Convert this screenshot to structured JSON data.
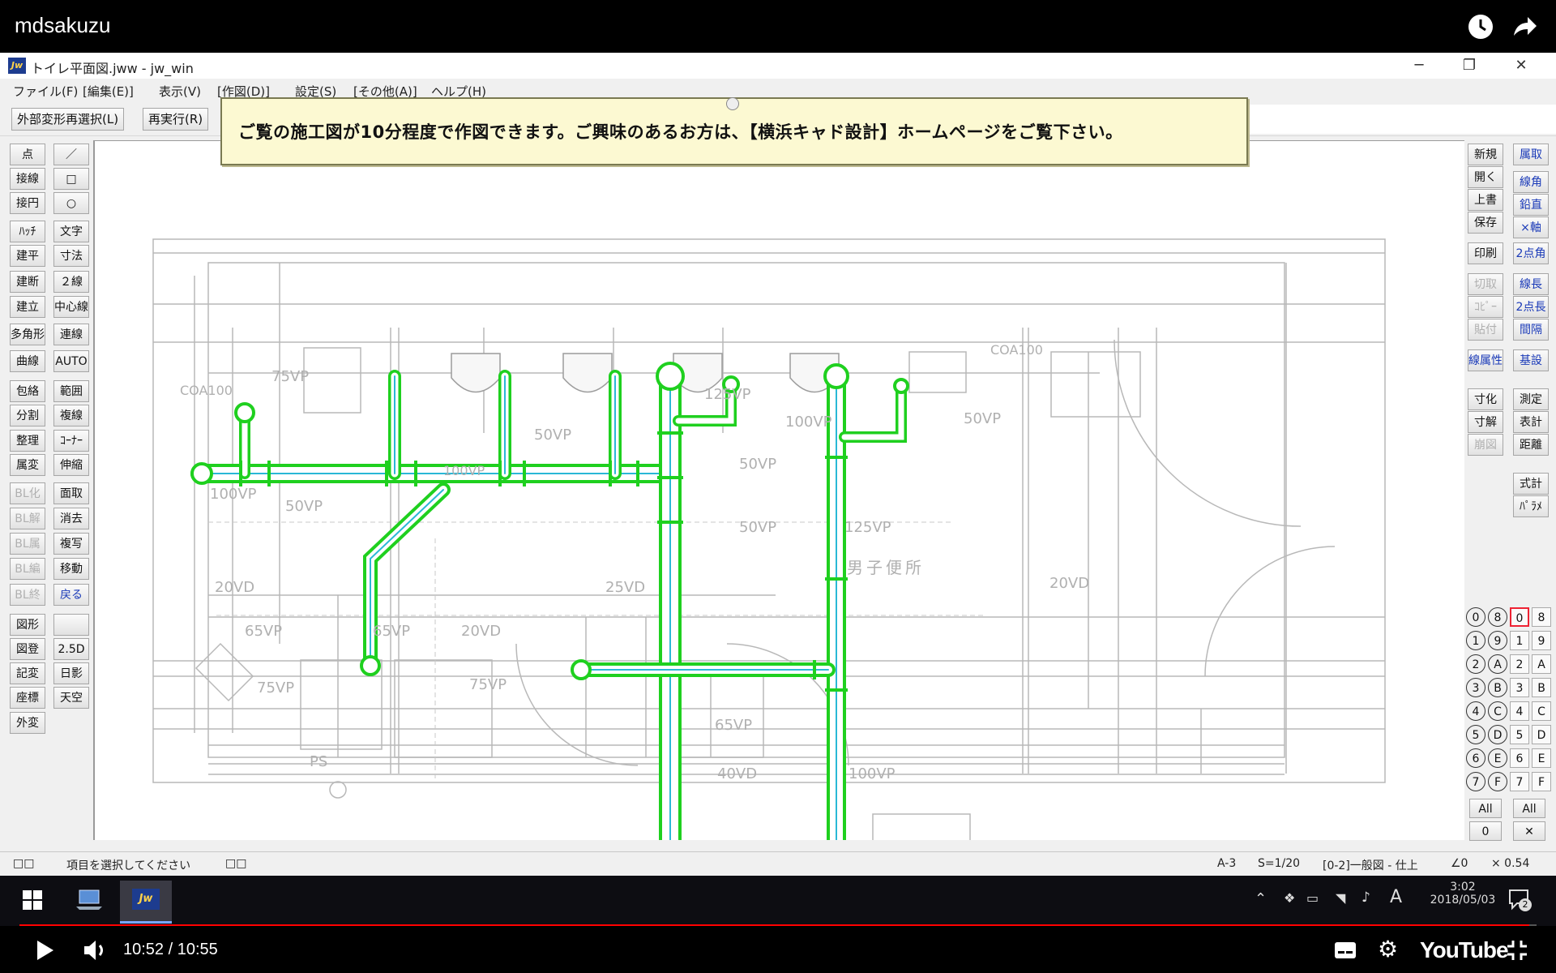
{
  "video": {
    "title": "mdsakuzu",
    "current_time": "10:52",
    "duration": "10:55",
    "time_display": "10:52 / 10:55",
    "progress": 0.995,
    "brand": "YouTube"
  },
  "window": {
    "title": "トイレ平面図.jww - jw_win",
    "app_icon_text": "Jw"
  },
  "menu": [
    "ファイル(F)",
    "[編集(E)]",
    "表示(V)",
    "[作図(D)]",
    "設定(S)",
    "[その他(A)]",
    "ヘルプ(H)"
  ],
  "command_bar": {
    "buttons": [
      "外部変形再選択(L)",
      "再実行(R)"
    ]
  },
  "left_tools": {
    "col1": [
      "点",
      "接線",
      "接円",
      "ﾊｯﾁ",
      "建平",
      "建断",
      "建立",
      "多角形",
      "曲線",
      "包絡",
      "分割",
      "整理",
      "属変",
      "BL化",
      "BL解",
      "BL属",
      "BL編",
      "BL終",
      "図形",
      "図登",
      "記変",
      "座標",
      "外変"
    ],
    "col2": [
      "／",
      "□",
      "○",
      "文字",
      "寸法",
      "２線",
      "中心線",
      "連線",
      "AUTO",
      "範囲",
      "複線",
      "ｺｰﾅｰ",
      "伸縮",
      "面取",
      "消去",
      "複写",
      "移動",
      "戻る",
      "",
      "2.5D",
      "日影",
      "天空"
    ]
  },
  "right_tools": {
    "col1": [
      "新規",
      "開く",
      "上書",
      "保存",
      "印刷",
      "切取",
      "ｺﾋﾟｰ",
      "貼付",
      "線属性",
      "寸化",
      "寸解",
      "崩図"
    ],
    "col2": [
      "属取",
      "線角",
      "鉛直",
      "×軸",
      "2点角",
      "線長",
      "2点長",
      "間隔",
      "基設",
      "測定",
      "表計",
      "距離",
      "式計",
      "ﾊﾟﾗﾒ"
    ]
  },
  "layer_palette": {
    "group_left": [
      "0",
      "1",
      "2",
      "3",
      "4",
      "5",
      "6",
      "7",
      "8",
      "9",
      "A",
      "B",
      "C",
      "D",
      "E",
      "F"
    ],
    "layer_right": [
      "0",
      "1",
      "2",
      "3",
      "4",
      "5",
      "6",
      "7",
      "8",
      "9",
      "A",
      "B",
      "C",
      "D",
      "E",
      "F"
    ],
    "all_label": "All",
    "zero_label": "0",
    "x_label": "✕"
  },
  "banner": {
    "text": "ご覧の施工図が10分程度で作図できます。ご興味のあるお方は、【横浜キャド設計】ホームページをご覧下さい。"
  },
  "drawing_labels": {
    "coa100_a": "COA100",
    "coa100_b": "COA100",
    "p75vp_a": "75VP",
    "p100vp_a": "100VP",
    "p50vp_a": "50VP",
    "p50vp_b": "50VP",
    "p100vp_b": "100VP",
    "p125vp_a": "125VP",
    "p100vp_c": "100VP",
    "p50vp_c": "50VP",
    "p50vp_d": "50VP",
    "p50vp_e": "50VP",
    "p20vd_a": "20VD",
    "p25vd": "25VD",
    "p20vd_b": "20VD",
    "p65vp_a": "65VP",
    "p65vp_b": "65VP",
    "p20vd_c": "20VD",
    "p125vp_b": "125VP",
    "p75vp_b": "75VP",
    "p75vp_c": "75VP",
    "p65vp_c": "65VP",
    "p40vd": "40VD",
    "p100vp_d": "100VP",
    "room": "男子便所",
    "ps": "PS"
  },
  "status": {
    "left_sq": "□□",
    "message": "項目を選択してください",
    "mid_sq": "□□",
    "paper": "A-3",
    "scale": "S=1/20",
    "layer": "[0-2]一般図 - 仕上",
    "angle": "∠0",
    "factor": "× 0.54"
  },
  "taskbar": {
    "time": "3:02",
    "date": "2018/05/03",
    "ime": "A",
    "notif_count": "2"
  },
  "colors": {
    "pipe_green": "#1fd01f",
    "pipe_cyan": "#2ab8d6",
    "banner_bg": "#fcf9d2",
    "progress_red": "#ff0000"
  }
}
